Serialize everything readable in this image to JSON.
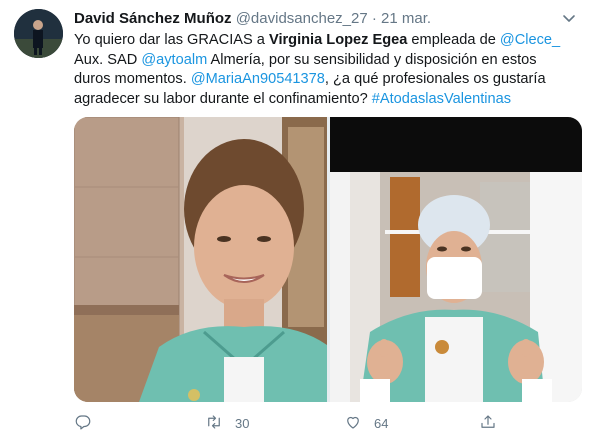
{
  "author": {
    "name": "David Sánchez Muñoz",
    "handle": "@davidsanchez_27",
    "separator": "·",
    "date": "21 mar."
  },
  "tweet": {
    "t1": "Yo quiero dar las GRACIAS a ",
    "t2": "Virginia Lopez Egea",
    "t3": " empleada de ",
    "m1": "@Clece_",
    "t4": " Aux. SAD ",
    "m2": "@aytoalm",
    "t5": " Almería, por su sensibilidad y disposición en estos duros momentos. ",
    "m3": "@MariaAn90541378",
    "t6": ", ¿a qué profesionales os gustaría agradecer su labor durante el confinamiento? ",
    "hashtag": "#AtodaslasValentinas"
  },
  "media": {
    "left_icon": "photo-woman-smiling",
    "right_icon": "photo-woman-mask-thumbs-up"
  },
  "actions": {
    "reply": {
      "icon": "reply-icon",
      "count": ""
    },
    "retweet": {
      "icon": "retweet-icon",
      "count": "30"
    },
    "like": {
      "icon": "heart-icon",
      "count": "64"
    },
    "share": {
      "icon": "share-icon",
      "count": ""
    }
  },
  "colors": {
    "link": "#1b95e0",
    "secondary_text": "#657786",
    "primary_text": "#14171a",
    "scrub_green": "#5fb8a8"
  }
}
